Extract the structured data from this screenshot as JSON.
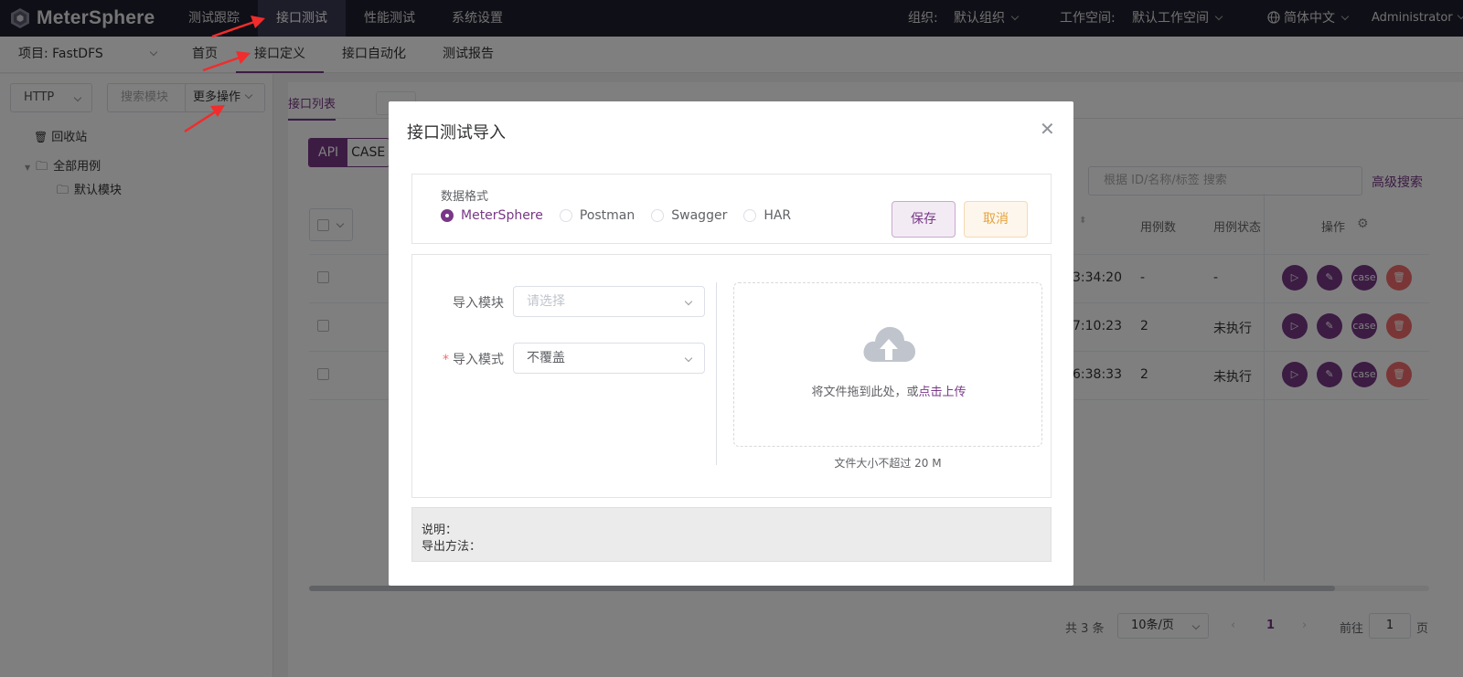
{
  "header": {
    "logo_text": "MeterSphere",
    "nav": [
      "测试跟踪",
      "接口测试",
      "性能测试",
      "系统设置"
    ],
    "active_nav": "接口测试",
    "org_label": "组织:",
    "org_value": "默认组织",
    "workspace_label": "工作空间:",
    "workspace_value": "默认工作空间",
    "language": "简体中文",
    "user": "Administrator"
  },
  "subnav": {
    "project": "项目: FastDFS",
    "items": [
      "首页",
      "接口定义",
      "接口自动化",
      "测试报告"
    ],
    "active": "接口定义"
  },
  "left_panel": {
    "protocol": "HTTP",
    "search_placeholder": "搜索模块",
    "more_ops": "更多操作",
    "recycle": "回收站",
    "all_cases": "全部用例",
    "default_module": "默认模块"
  },
  "main": {
    "tab": "接口列表",
    "toggle": [
      "API",
      "CASE"
    ],
    "search_placeholder": "根据 ID/名称/标签 搜索",
    "advanced_search": "高级搜索",
    "columns": {
      "case_count": "用例数",
      "case_status": "用例状态",
      "ops": "操作"
    },
    "rows": [
      {
        "time": "3:34:20",
        "count": "-",
        "status": "-"
      },
      {
        "time": "7:10:23",
        "count": "2",
        "status": "未执行"
      },
      {
        "time": "6:38:33",
        "count": "2",
        "status": "未执行"
      }
    ],
    "op_case_label": "case",
    "pagination": {
      "total": "共 3 条",
      "page_size": "10条/页",
      "page": "1",
      "goto_label": "前往",
      "goto_value": "1",
      "page_suffix": "页"
    }
  },
  "dialog": {
    "title": "接口测试导入",
    "format_label": "数据格式",
    "formats": [
      "MeterSphere",
      "Postman",
      "Swagger",
      "HAR"
    ],
    "selected_format": "MeterSphere",
    "save": "保存",
    "cancel": "取消",
    "module_label": "导入模块",
    "module_placeholder": "请选择",
    "mode_label": "导入模式",
    "mode_value": "不覆盖",
    "upload_text": "将文件拖到此处，或",
    "upload_link": "点击上传",
    "size_tip": "文件大小不超过 20 M",
    "note_label": "说明：",
    "export_label": "导出方法："
  },
  "colors": {
    "primary": "#783887",
    "header_bg": "#1f1e2e",
    "danger": "#f56c6c",
    "cancel": "#e6a23c",
    "arrow": "#f02c2c"
  }
}
